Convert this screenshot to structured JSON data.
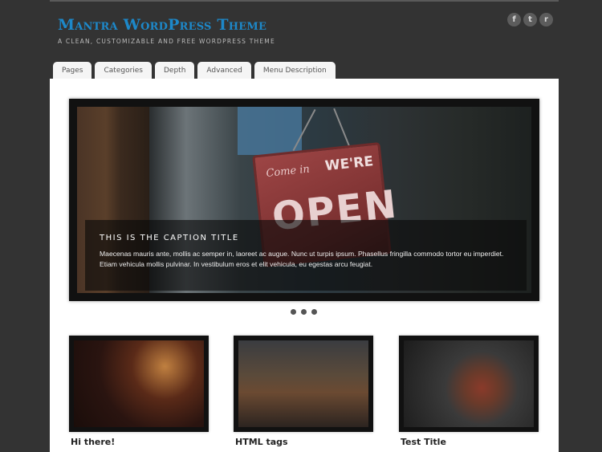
{
  "site": {
    "title": "Mantra WordPress Theme",
    "description": "A clean, customizable and free WordPress theme"
  },
  "social": [
    {
      "icon": "facebook-icon",
      "glyph": "f"
    },
    {
      "icon": "twitter-icon",
      "glyph": "t"
    },
    {
      "icon": "rss-icon",
      "glyph": "r"
    }
  ],
  "nav": {
    "tabs": [
      "Pages",
      "Categories",
      "Depth",
      "Advanced",
      "Menu Description"
    ]
  },
  "slider": {
    "sign_text_1": "Come in",
    "sign_text_2": "WE'RE",
    "sign_text_3": "OPEN",
    "caption_title": "This is the caption title",
    "caption_text": "Maecenas mauris ante, mollis ac semper in, laoreet ac augue. Nunc ut turpis ipsum. Phasellus fringilla commodo tortor eu imperdiet. Etiam vehicula mollis pulvinar. In vestibulum eros et elit vehicula, eu egestas arcu feugiat."
  },
  "posts": [
    {
      "title": "Hi there!"
    },
    {
      "title": "HTML tags"
    },
    {
      "title": "Test Title"
    }
  ],
  "colors": {
    "background": "#333333",
    "accent": "#1d88c9",
    "content": "#ffffff"
  }
}
